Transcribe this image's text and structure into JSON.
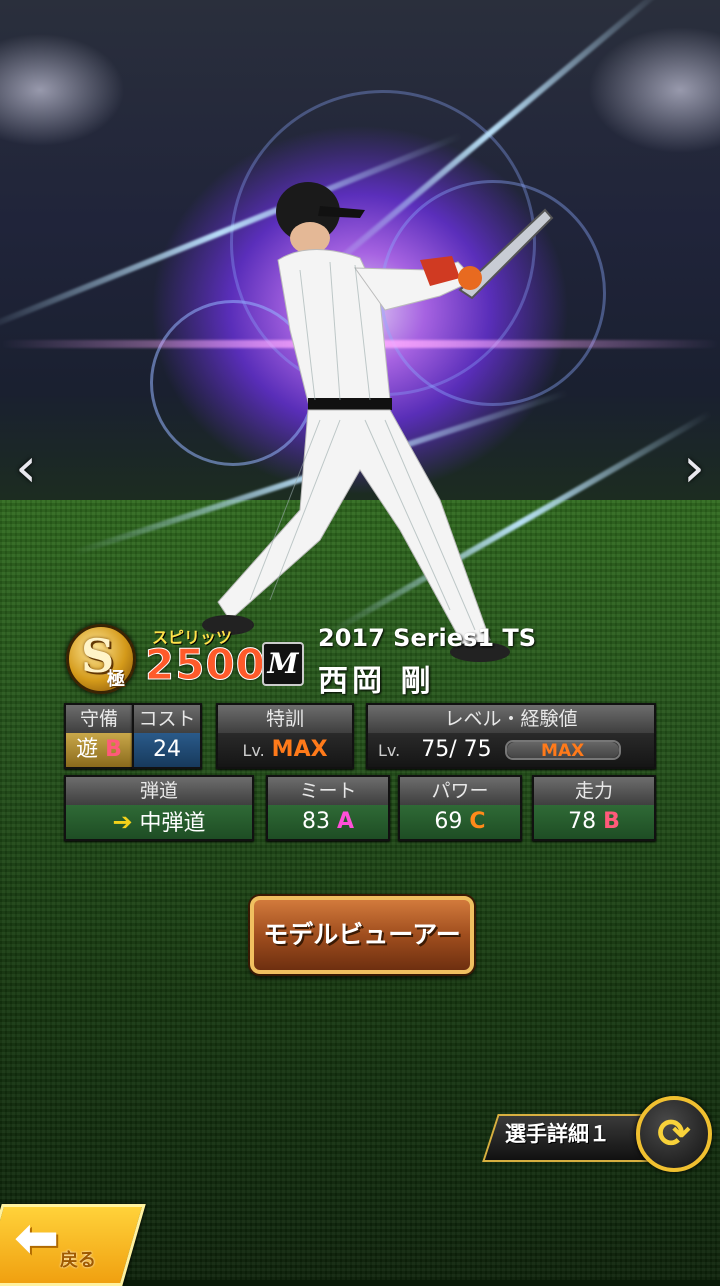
{
  "card": {
    "rarity": "S",
    "rarity_sub": "極",
    "spirits_label": "スピリッツ",
    "spirits_value": "2500",
    "team_logo": "M",
    "series": "2017 Series1 TS",
    "player_name": "西岡 剛"
  },
  "stats": {
    "position_header": "守備",
    "position_value": "遊",
    "position_grade": "B",
    "cost_header": "コスト",
    "cost_value": "24",
    "training_header": "特訓",
    "training_lv": "Lv.",
    "training_value": "MAX",
    "level_header": "レベル・経験値",
    "level_lv": "Lv.",
    "level_current": "75/",
    "level_max": "75",
    "exp_label": "MAX",
    "exp_fill": 1.0,
    "trajectory_header": "弾道",
    "trajectory_value": "中弾道",
    "meet_header": "ミート",
    "meet_value": "83",
    "meet_grade": "A",
    "power_header": "パワー",
    "power_value": "69",
    "power_grade": "C",
    "speed_header": "走力",
    "speed_value": "78",
    "speed_grade": "B"
  },
  "buttons": {
    "model_viewer": "モデルビューアー",
    "player_detail": "選手詳細１",
    "back": "戻る"
  },
  "nav": {
    "prev": "‹",
    "next": "›"
  },
  "icons": {
    "switch": "refresh-icon",
    "back_arrow": "back-arrow-icon"
  },
  "colors": {
    "grade_A": "#ff4fd8",
    "grade_B": "#ff5a7a",
    "grade_C": "#ff8a1a",
    "max": "#ff7a1a",
    "gold": "#f0c030"
  }
}
